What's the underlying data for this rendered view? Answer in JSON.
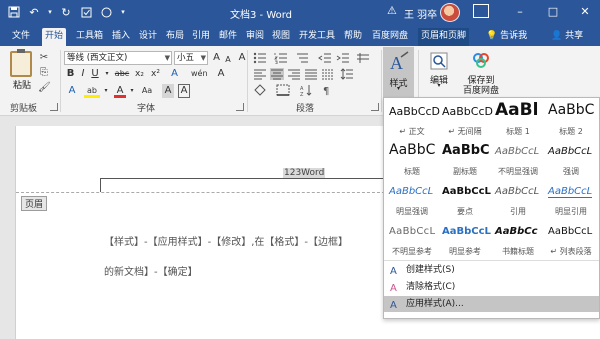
{
  "window": {
    "title": "文档3 - Word",
    "user": "王 羽卒",
    "controls": {
      "minimize": "–",
      "maximize": "□",
      "close": "✕"
    },
    "qat_icons": [
      "save-icon",
      "undo-icon",
      "redo-icon",
      "checkbox-icon",
      "circle-icon",
      "customize-icon"
    ]
  },
  "tabs": [
    {
      "label": "文件"
    },
    {
      "label": "开始",
      "active": true
    },
    {
      "label": "工具箱"
    },
    {
      "label": "插入"
    },
    {
      "label": "设计"
    },
    {
      "label": "布局"
    },
    {
      "label": "引用"
    },
    {
      "label": "邮件"
    },
    {
      "label": "审阅"
    },
    {
      "label": "视图"
    },
    {
      "label": "开发工具"
    },
    {
      "label": "帮助"
    },
    {
      "label": "百度网盘"
    },
    {
      "label": "页眉和页脚"
    }
  ],
  "tell_me": "告诉我",
  "share": "共享",
  "ribbon": {
    "clipboard": {
      "label": "剪贴板",
      "paste": "粘贴"
    },
    "font": {
      "label": "字体",
      "font_name": "等线 (西文正文)",
      "font_size": "小五",
      "bold": "B",
      "italic": "I",
      "underline": "U",
      "strike": "abc",
      "subscript": "x₂",
      "superscript": "x²",
      "font_color": "A",
      "highlight": "ab",
      "phonetic": "wén",
      "grow": "A",
      "shrink": "A",
      "change_case": "Aa",
      "clear": "A",
      "enclose": "A"
    },
    "paragraph": {
      "label": "段落"
    },
    "styles": {
      "label": "样式"
    },
    "editing": {
      "label": "编辑"
    },
    "save_baidu": {
      "line1": "保存到",
      "line2": "百度网盘"
    }
  },
  "document": {
    "header_text": "123Word",
    "header_tag": "页眉",
    "line1": "【样式】-【应用样式】-【修改】,在【格式】-【边框】",
    "line2": "的新文档】-【确定】"
  },
  "styles_panel": {
    "items": [
      {
        "sample": "AaBbCcD",
        "name": "↵ 正文"
      },
      {
        "sample": "AaBbCcD",
        "name": "↵ 无间隔"
      },
      {
        "sample": "AaBl",
        "name": "标题 1"
      },
      {
        "sample": "AaBbC",
        "name": "标题 2"
      },
      {
        "sample": "AaBbC",
        "name": "标题"
      },
      {
        "sample": "AaBbC",
        "name": "副标题"
      },
      {
        "sample": "AaBbCcL",
        "name": "不明显强调"
      },
      {
        "sample": "AaBbCcL",
        "name": "强调"
      },
      {
        "sample": "AaBbCcL",
        "name": "明显强调"
      },
      {
        "sample": "AaBbCcL",
        "name": "要点"
      },
      {
        "sample": "AaBbCcL",
        "name": "引用"
      },
      {
        "sample": "AaBbCcL",
        "name": "明显引用"
      },
      {
        "sample": "AaBbCcL",
        "name": "不明显参考"
      },
      {
        "sample": "AaBbCcL",
        "name": "明显参考"
      },
      {
        "sample": "AaBbCc",
        "name": "书籍标题"
      },
      {
        "sample": "AaBbCcL",
        "name": "↵ 列表段落"
      }
    ],
    "actions": [
      {
        "label": "创建样式(S)",
        "icon": "create-style-icon"
      },
      {
        "label": "清除格式(C)",
        "icon": "clear-format-icon"
      },
      {
        "label": "应用样式(A)...",
        "icon": "apply-styles-icon"
      }
    ]
  },
  "colors": {
    "accent": "#2b579a",
    "highlight_menu": "#c5c5c5",
    "font_color_red": "#e03030",
    "highlight_yellow": "#ffee00"
  }
}
